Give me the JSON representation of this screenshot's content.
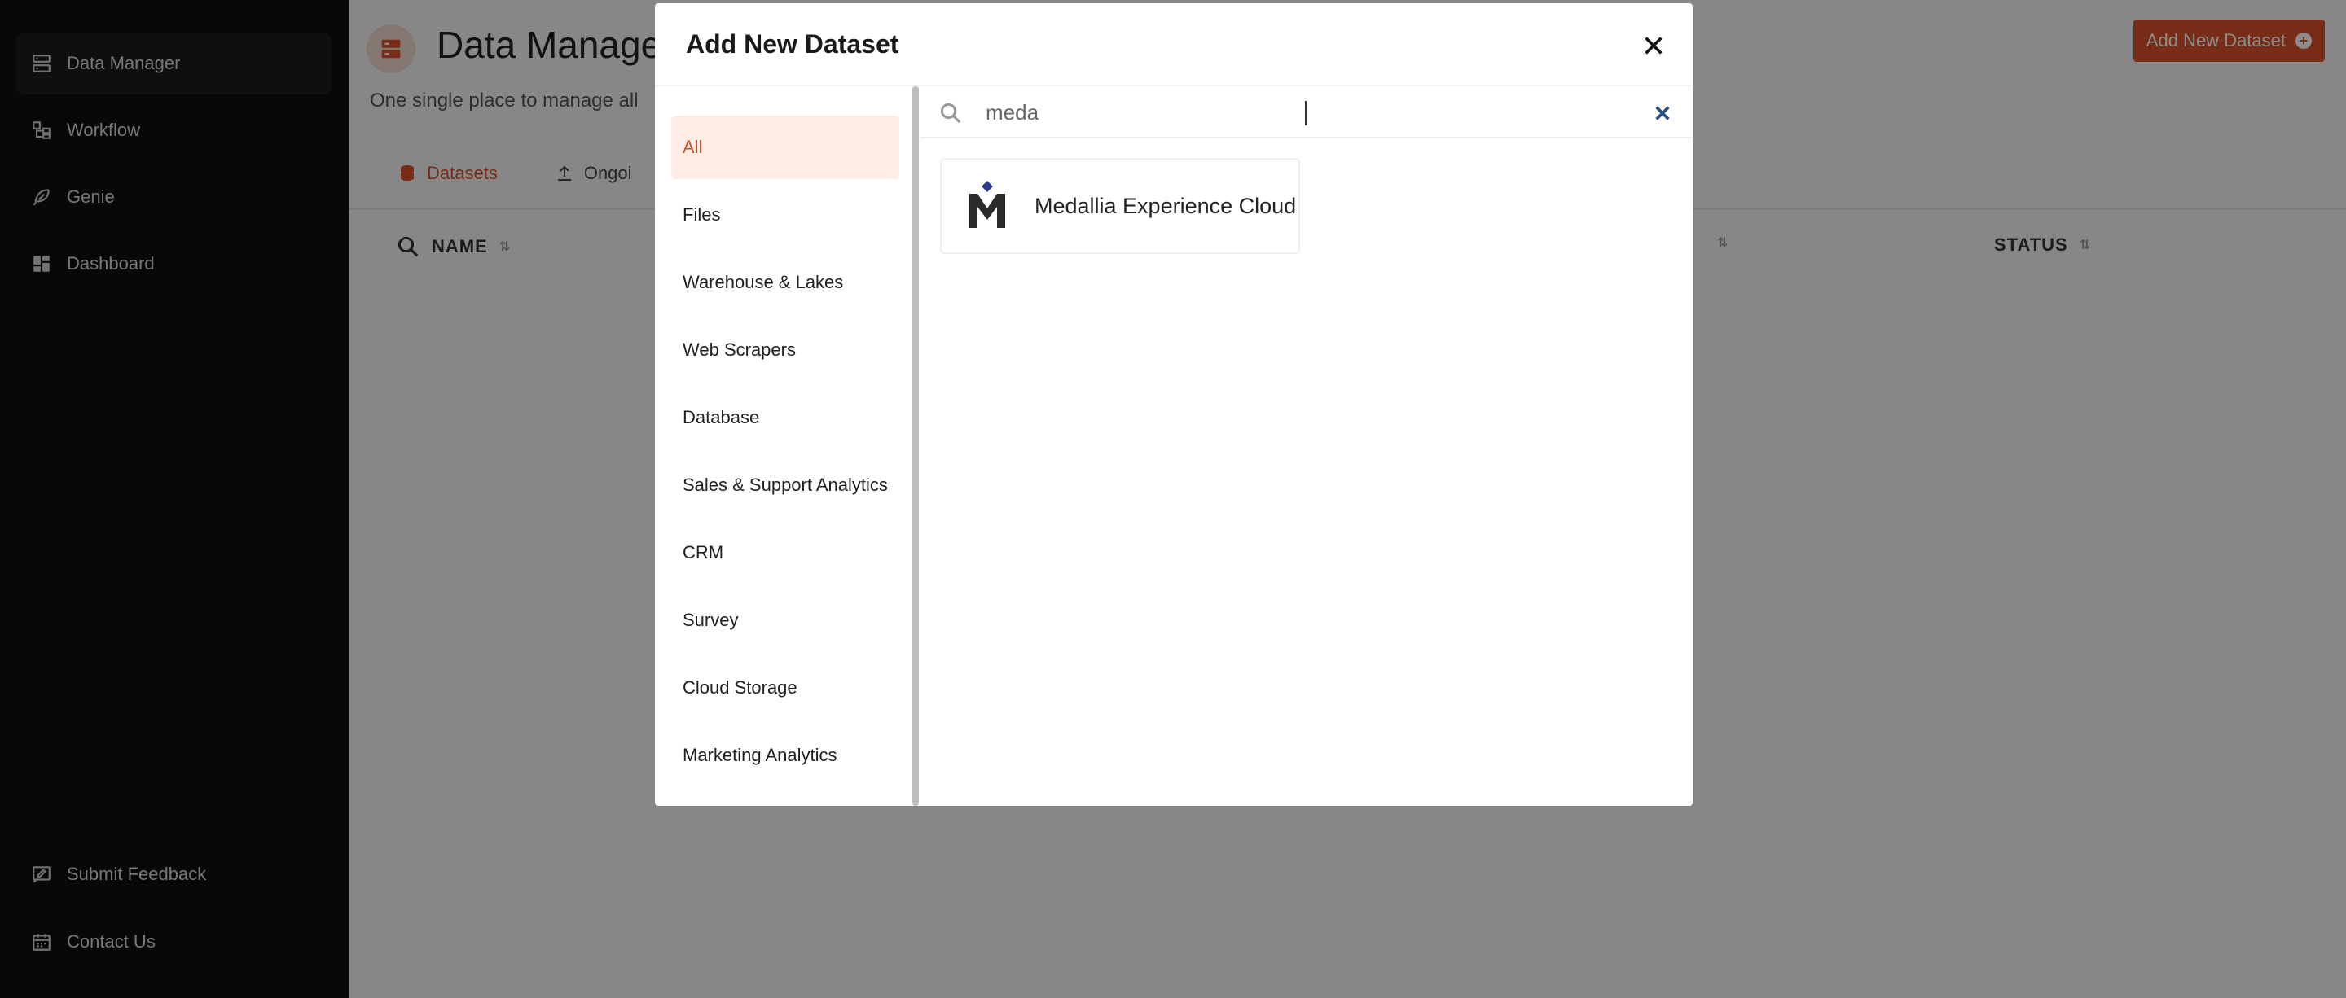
{
  "sidebar": {
    "items": [
      {
        "label": "Data Manager",
        "icon": "database-icon"
      },
      {
        "label": "Workflow",
        "icon": "workflow-icon"
      },
      {
        "label": "Genie",
        "icon": "feather-icon"
      },
      {
        "label": "Dashboard",
        "icon": "dashboard-icon"
      }
    ],
    "bottom_items": [
      {
        "label": "Submit Feedback",
        "icon": "feedback-icon"
      },
      {
        "label": "Contact Us",
        "icon": "calendar-icon"
      }
    ]
  },
  "page": {
    "title": "Data Manage",
    "subtitle": "One single place to manage all",
    "add_button_label": "Add New Dataset",
    "tabs": [
      {
        "label": "Datasets",
        "icon": "database-icon"
      },
      {
        "label": "Ongoi",
        "icon": "upload-icon"
      }
    ],
    "columns": [
      {
        "label": "NAME"
      },
      {
        "label": ""
      },
      {
        "label": "STATUS"
      }
    ]
  },
  "modal": {
    "title": "Add New Dataset",
    "categories": [
      "All",
      "Files",
      "Warehouse & Lakes",
      "Web Scrapers",
      "Database",
      "Sales & Support Analytics",
      "CRM",
      "Survey",
      "Cloud Storage",
      "Marketing Analytics"
    ],
    "active_category": "All",
    "search": {
      "value": "meda",
      "placeholder": ""
    },
    "results": [
      {
        "name": "Medallia Experience Cloud",
        "icon": "medallia-logo"
      }
    ]
  },
  "colors": {
    "accent": "#d9532b",
    "sidebar_bg": "#0f0f0f",
    "active_category_bg": "#fdede4",
    "clear_icon": "#2a4e86"
  }
}
